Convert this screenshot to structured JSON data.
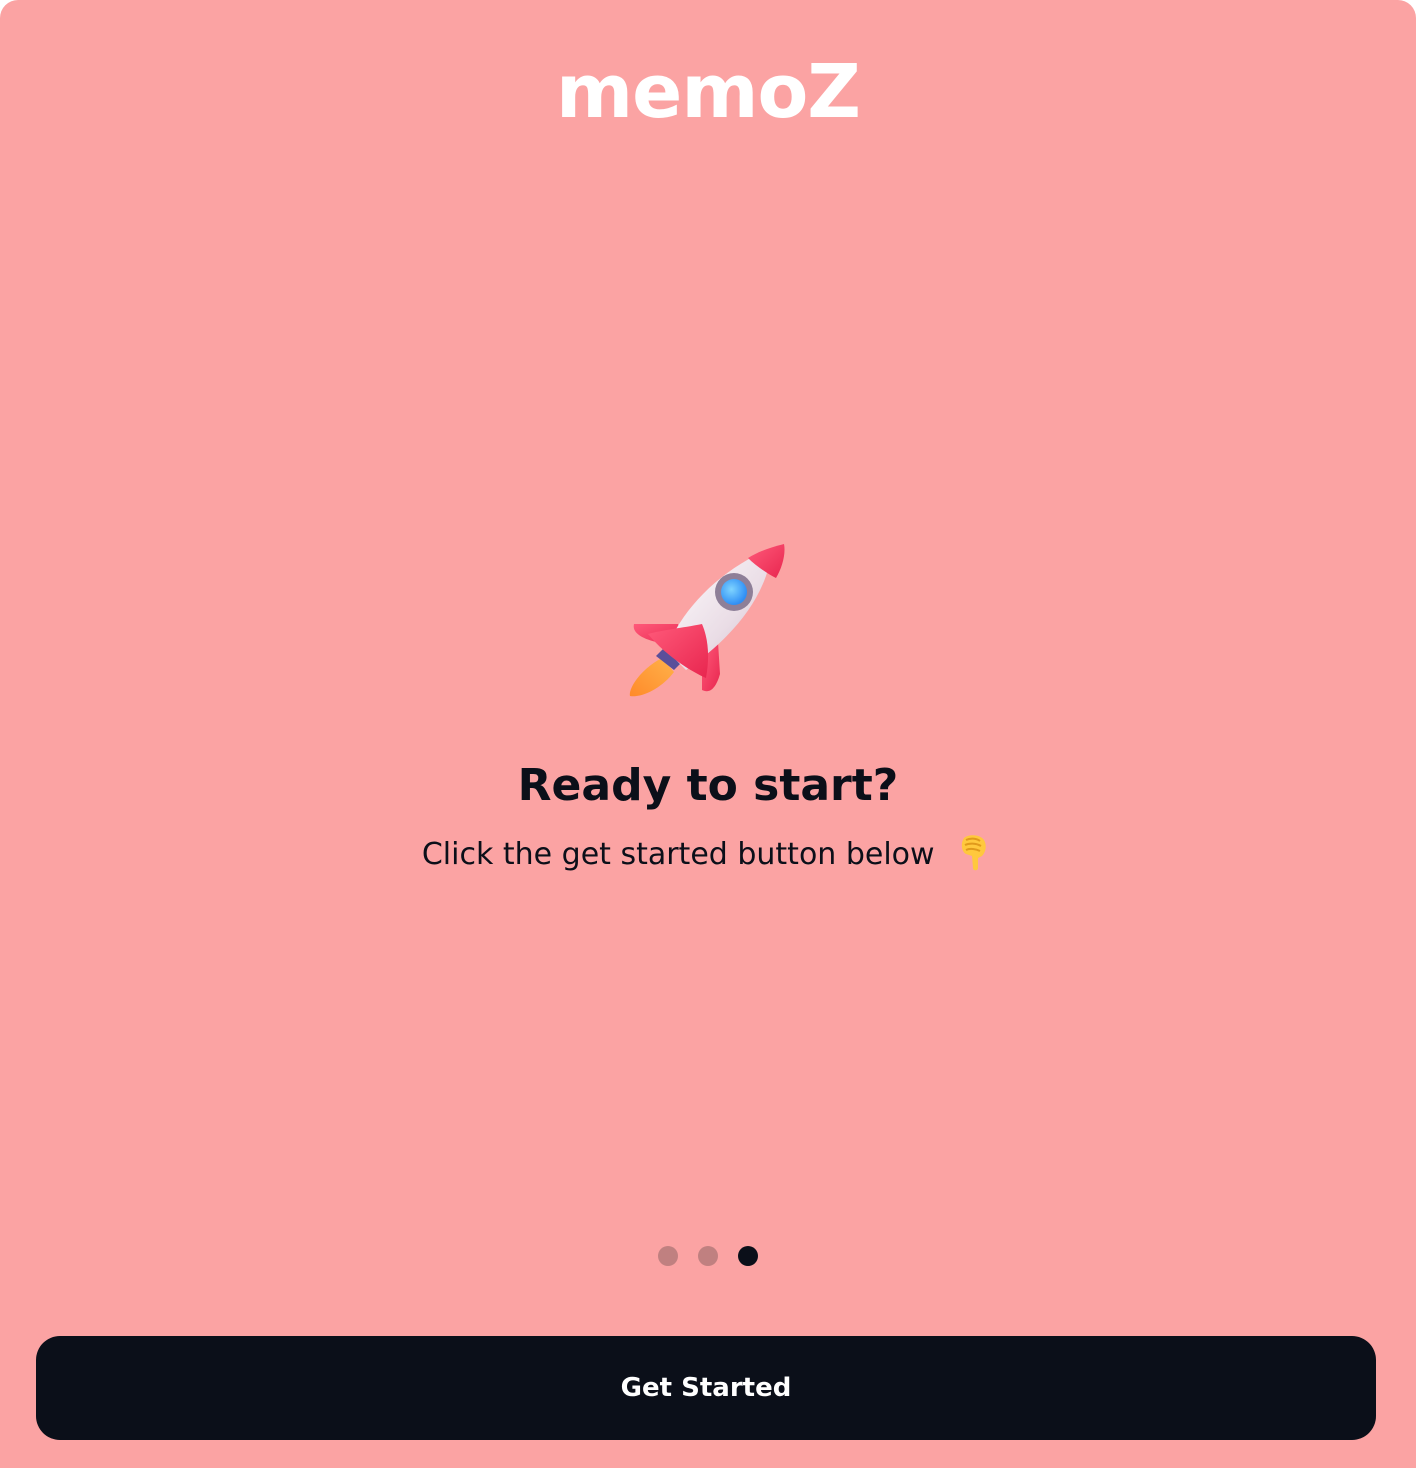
{
  "app": {
    "brand": "memoZ"
  },
  "onboarding": {
    "illustration_icon": "rocket-icon",
    "title": "Ready to start?",
    "subtitle": "Click the get started button below",
    "subtitle_icon": "pointing-down-hand-icon",
    "pagination": {
      "total": 3,
      "current": 3
    },
    "cta_label": "Get Started"
  },
  "colors": {
    "background": "#fba3a3",
    "brand_text": "#ffffff",
    "primary_text": "#0b0f19",
    "button_background": "#0b0f19",
    "button_text": "#ffffff",
    "dot_inactive": "#c08080",
    "dot_active": "#0b0f19"
  }
}
